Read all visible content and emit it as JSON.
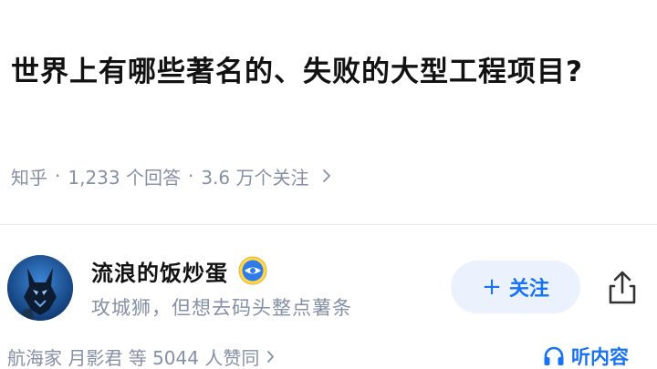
{
  "question": {
    "title": "世界上有哪些著名的、失败的大型工程项目?"
  },
  "meta": {
    "source": "知乎",
    "separator": "·",
    "answers": "1,233 个回答",
    "followers": "3.6 万个关注"
  },
  "author": {
    "name": "流浪的饭炒蛋",
    "bio": "攻城狮，但想去码头整点薯条"
  },
  "actions": {
    "follow_plus": "+",
    "follow_label": "关注",
    "listen_label": "听内容"
  },
  "voters": {
    "text": "航海家 月影君 等 5044 人赞同"
  },
  "colors": {
    "accent": "#1772f6",
    "follow_bg": "#ecf2fd",
    "meta_gray": "#8590a6",
    "title": "#121212"
  },
  "icons": {
    "meta_chevron": "chevron-right-icon",
    "badge": "blue-badge-icon",
    "share": "share-icon",
    "listen": "headphones-icon"
  }
}
